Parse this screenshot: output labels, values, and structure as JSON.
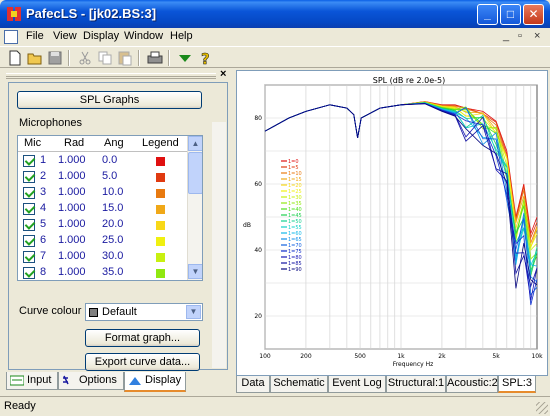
{
  "window": {
    "title": "PafecLS - [jk02.BS:3]"
  },
  "menu": [
    "File",
    "View",
    "Display",
    "Window",
    "Help"
  ],
  "mdi_controls": [
    "_",
    "▫",
    "×"
  ],
  "toolbar": {
    "icons": [
      "new-icon",
      "open-icon",
      "save-icon",
      "cut-icon",
      "copy-icon",
      "paste-icon",
      "print-icon",
      "dropdown-arrow-icon",
      "help-icon"
    ],
    "arrow_color": "#1a8a1a"
  },
  "panel": {
    "close": "×",
    "spl_graphs_button": "SPL Graphs",
    "microphones_label": "Microphones",
    "columns": [
      "Mic",
      "Rad",
      "Ang",
      "Legend"
    ],
    "rows": [
      {
        "mic": "1",
        "rad": "1.000",
        "ang": "0.0",
        "color": "#e01010"
      },
      {
        "mic": "2",
        "rad": "1.000",
        "ang": "5.0",
        "color": "#e03a10"
      },
      {
        "mic": "3",
        "rad": "1.000",
        "ang": "10.0",
        "color": "#e87a10"
      },
      {
        "mic": "4",
        "rad": "1.000",
        "ang": "15.0",
        "color": "#f0a818"
      },
      {
        "mic": "5",
        "rad": "1.000",
        "ang": "20.0",
        "color": "#f8d818"
      },
      {
        "mic": "6",
        "rad": "1.000",
        "ang": "25.0",
        "color": "#f0f010"
      },
      {
        "mic": "7",
        "rad": "1.000",
        "ang": "30.0",
        "color": "#c8f010"
      },
      {
        "mic": "8",
        "rad": "1.000",
        "ang": "35.0",
        "color": "#90e810"
      }
    ],
    "curve_colour_label": "Curve colour",
    "curve_colour_value": "Default",
    "format_button": "Format graph...",
    "export_button": "Export curve data..."
  },
  "left_tabs": [
    {
      "label": "Input",
      "icon": "input-icon"
    },
    {
      "label": "Options",
      "icon": "options-icon"
    },
    {
      "label": "Display",
      "icon": "display-icon",
      "active": true
    }
  ],
  "right_tabs": [
    {
      "label": "Data"
    },
    {
      "label": "Schematic"
    },
    {
      "label": "Event Log"
    },
    {
      "label": "Structural:1"
    },
    {
      "label": "Acoustic:2"
    },
    {
      "label": "SPL:3",
      "active": true
    }
  ],
  "status": {
    "text": "Ready"
  },
  "chart_data": {
    "type": "line",
    "title": "SPL (dB re 2.0e-5)",
    "xlabel": "Frequency Hz",
    "ylabel": "dB",
    "xscale": "log",
    "xlim": [
      100,
      10000
    ],
    "ylim": [
      10,
      90
    ],
    "x_ticks": [
      "100",
      "200",
      "500",
      "1k",
      "2k",
      "5k",
      "10k"
    ],
    "x_tick_values": [
      100,
      200,
      500,
      1000,
      2000,
      5000,
      10000
    ],
    "y_ticks": [
      "20",
      "40",
      "60",
      "80"
    ],
    "y_tick_values": [
      20,
      40,
      60,
      80
    ],
    "grid": true,
    "legend_location": "left",
    "series": [
      {
        "name": "1=0",
        "color": "#e01010"
      },
      {
        "name": "1=5",
        "color": "#e03a10"
      },
      {
        "name": "1=10",
        "color": "#e87a10"
      },
      {
        "name": "1=15",
        "color": "#f0a818"
      },
      {
        "name": "1=20",
        "color": "#f8d818"
      },
      {
        "name": "1=25",
        "color": "#f0f010"
      },
      {
        "name": "1=30",
        "color": "#c8f010"
      },
      {
        "name": "1=35",
        "color": "#90e810"
      },
      {
        "name": "1=40",
        "color": "#50e020"
      },
      {
        "name": "1=45",
        "color": "#20d050"
      },
      {
        "name": "1=50",
        "color": "#10d090"
      },
      {
        "name": "1=55",
        "color": "#10d0c8"
      },
      {
        "name": "1=60",
        "color": "#10b8e8"
      },
      {
        "name": "1=65",
        "color": "#1090e8"
      },
      {
        "name": "1=70",
        "color": "#1060e0"
      },
      {
        "name": "1=75",
        "color": "#1030d0"
      },
      {
        "name": "1=80",
        "color": "#1818b8"
      },
      {
        "name": "1=85",
        "color": "#1010a0"
      },
      {
        "name": "1=90",
        "color": "#080880"
      }
    ],
    "base_curve": [
      [
        100,
        76
      ],
      [
        150,
        80
      ],
      [
        200,
        82
      ],
      [
        300,
        84
      ],
      [
        400,
        83
      ],
      [
        450,
        81
      ],
      [
        480,
        74
      ],
      [
        510,
        80
      ],
      [
        700,
        83
      ],
      [
        1000,
        84
      ],
      [
        1500,
        85
      ],
      [
        2000,
        84
      ],
      [
        2500,
        84
      ],
      [
        3000,
        83
      ],
      [
        4000,
        82
      ],
      [
        5000,
        79
      ],
      [
        6000,
        70
      ],
      [
        7000,
        50
      ],
      [
        8000,
        60
      ],
      [
        9000,
        45
      ],
      [
        10000,
        50
      ]
    ]
  }
}
